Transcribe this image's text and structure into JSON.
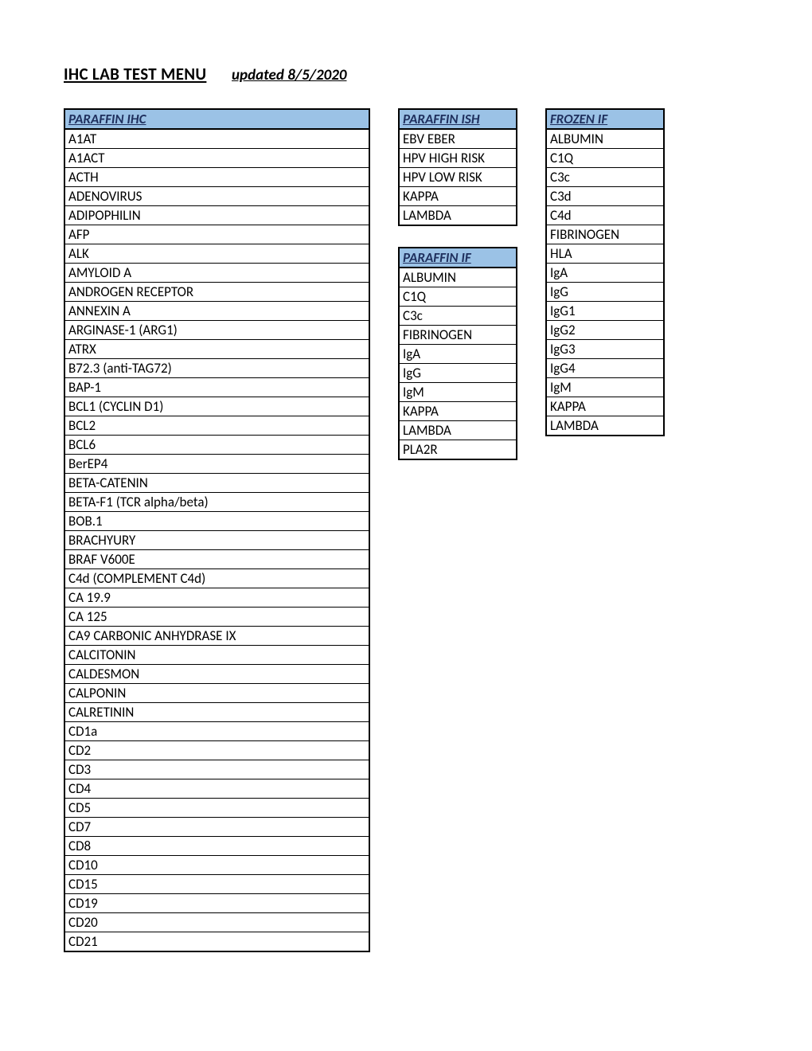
{
  "title": {
    "main": "IHC LAB TEST MENU",
    "updated": "updated 8/5/2020"
  },
  "colors": {
    "header_bg": "#9bc2e6",
    "header_fg": "#1f305e"
  },
  "chart_data": {
    "type": "table",
    "tables": {
      "paraffin_ihc": {
        "header": "PARAFFIN IHC",
        "items": [
          "A1AT",
          "A1ACT",
          "ACTH",
          "ADENOVIRUS",
          "ADIPOPHILIN",
          "AFP",
          "ALK",
          "AMYLOID A",
          "ANDROGEN RECEPTOR",
          "ANNEXIN A",
          "ARGINASE-1 (ARG1)",
          "ATRX",
          "B72.3 (anti-TAG72)",
          "BAP-1",
          "BCL1 (CYCLIN D1)",
          "BCL2",
          "BCL6",
          "BerEP4",
          "BETA-CATENIN",
          "BETA-F1 (TCR alpha/beta)",
          "BOB.1",
          "BRACHYURY",
          "BRAF V600E",
          "C4d (COMPLEMENT C4d)",
          "CA 19.9",
          "CA 125",
          "CA9 CARBONIC ANHYDRASE IX",
          "CALCITONIN",
          "CALDESMON",
          "CALPONIN",
          "CALRETININ",
          "CD1a",
          "CD2",
          "CD3",
          "CD4",
          "CD5",
          "CD7",
          "CD8",
          "CD10",
          "CD15",
          "CD19",
          "CD20",
          "CD21"
        ]
      },
      "paraffin_ish": {
        "header": "PARAFFIN ISH",
        "items": [
          "EBV EBER",
          "HPV HIGH RISK",
          "HPV LOW RISK",
          "KAPPA",
          "LAMBDA"
        ]
      },
      "paraffin_if": {
        "header": "PARAFFIN IF",
        "items": [
          "ALBUMIN",
          "C1Q",
          "C3c",
          "FIBRINOGEN",
          "IgA",
          "IgG",
          "IgM",
          "KAPPA",
          "LAMBDA",
          "PLA2R"
        ]
      },
      "frozen_if": {
        "header": "FROZEN IF",
        "items": [
          "ALBUMIN",
          "C1Q",
          "C3c",
          "C3d",
          "C4d",
          "FIBRINOGEN",
          "HLA",
          "IgA",
          "IgG",
          "IgG1",
          "IgG2",
          "IgG3",
          "IgG4",
          "IgM",
          "KAPPA",
          "LAMBDA"
        ]
      }
    }
  }
}
